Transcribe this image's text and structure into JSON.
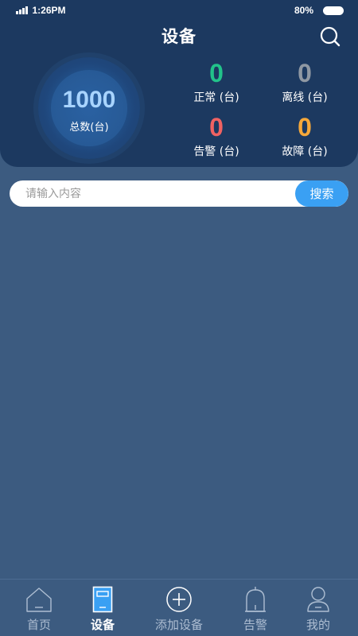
{
  "status_bar": {
    "time": "1:26PM",
    "battery": "80%"
  },
  "header": {
    "title": "设备"
  },
  "summary": {
    "total_value": "1000",
    "total_label": "总数(台)",
    "stats": [
      {
        "value": "0",
        "label": "正常 (台)",
        "color": "#22c38a"
      },
      {
        "value": "0",
        "label": "离线 (台)",
        "color": "#8f98a3"
      },
      {
        "value": "0",
        "label": "告警 (台)",
        "color": "#f06262"
      },
      {
        "value": "0",
        "label": "故障 (台)",
        "color": "#f5a83a"
      }
    ]
  },
  "search": {
    "placeholder": "请输入内容",
    "button_label": "搜索"
  },
  "nav": {
    "items": [
      {
        "label": "首页",
        "icon": "home-icon"
      },
      {
        "label": "设备",
        "icon": "device-icon",
        "active": true
      },
      {
        "label": "添加设备",
        "icon": "add-circle-icon"
      },
      {
        "label": "告警",
        "icon": "bell-icon"
      },
      {
        "label": "我的",
        "icon": "user-icon"
      }
    ]
  },
  "colors": {
    "background": "#3c5b80",
    "header_bg": "#1c3960",
    "accent": "#3aa0f3",
    "total_value": "#a8d4ff"
  }
}
